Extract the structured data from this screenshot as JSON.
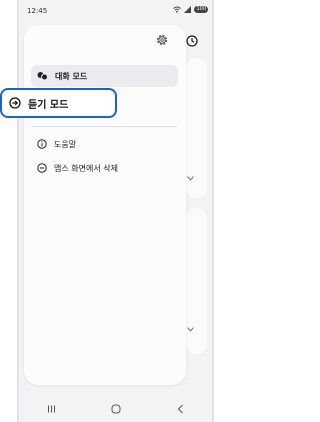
{
  "status_bar": {
    "time": "12:45",
    "battery": "100",
    "icons": [
      "wifi-icon",
      "signal-icon",
      "battery-icon"
    ]
  },
  "menu": {
    "conversation_mode": "대화 모드",
    "listening_mode": "듣기 모드",
    "help": "도움말",
    "remove_apps_screen": "앱스 화면에서 삭제"
  },
  "nav_bar": {
    "buttons": [
      "recents-button",
      "home-button",
      "back-button"
    ]
  },
  "colors": {
    "highlight_border": "#1b64c9",
    "selected_background": "#ebebef",
    "panel_background": "#fcfcfd"
  }
}
